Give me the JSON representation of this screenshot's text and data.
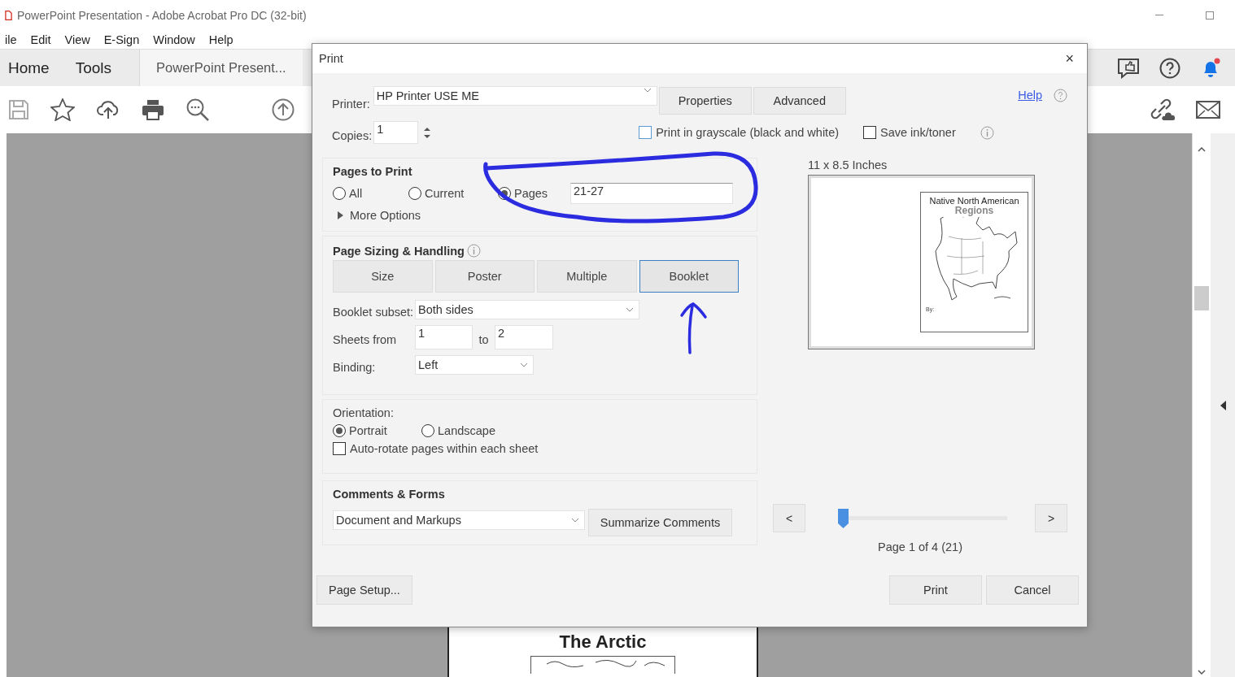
{
  "window": {
    "title": "PowerPoint Presentation - Adobe Acrobat Pro DC (32-bit)"
  },
  "menu": [
    "ile",
    "Edit",
    "View",
    "E-Sign",
    "Window",
    "Help"
  ],
  "tabs": [
    {
      "label": "Home",
      "selected": false
    },
    {
      "label": "Tools",
      "selected": false
    },
    {
      "label": "PowerPoint Present...",
      "selected": true
    }
  ],
  "notifications": {
    "unread": true
  },
  "document": {
    "page_title": "The Arctic"
  },
  "print_dialog": {
    "title": "Print",
    "close": "×",
    "printer": {
      "label": "Printer:",
      "value": "HP Printer USE ME"
    },
    "properties_button": "Properties",
    "advanced_button": "Advanced",
    "help_link": "Help",
    "copies": {
      "label": "Copies:",
      "value": "1"
    },
    "grayscale": {
      "label": "Print in grayscale (black and white)",
      "checked": false
    },
    "save_ink": {
      "label": "Save ink/toner",
      "checked": false
    },
    "pages_to_print": {
      "heading": "Pages to Print",
      "options": [
        {
          "label": "All",
          "selected": false
        },
        {
          "label": "Current",
          "selected": false
        },
        {
          "label": "Pages",
          "selected": true
        }
      ],
      "pages_value": "21-27",
      "more_options": "More Options"
    },
    "sizing": {
      "heading": "Page Sizing & Handling",
      "tabs": [
        {
          "label": "Size",
          "selected": false
        },
        {
          "label": "Poster",
          "selected": false
        },
        {
          "label": "Multiple",
          "selected": false
        },
        {
          "label": "Booklet",
          "selected": true
        }
      ],
      "booklet_subset": {
        "label": "Booklet subset:",
        "value": "Both sides"
      },
      "sheets": {
        "label": "Sheets from",
        "from": "1",
        "to_label": "to",
        "to": "2"
      },
      "binding": {
        "label": "Binding:",
        "value": "Left"
      }
    },
    "orientation": {
      "heading": "Orientation:",
      "options": [
        {
          "label": "Portrait",
          "selected": true
        },
        {
          "label": "Landscape",
          "selected": false
        }
      ],
      "auto_rotate": {
        "label": "Auto-rotate pages within each sheet",
        "checked": false
      }
    },
    "comments_forms": {
      "heading": "Comments & Forms",
      "value": "Document and Markups",
      "button": "Summarize Comments"
    },
    "preview": {
      "size": "11 x 8.5 Inches",
      "page_title": "Native North American",
      "page_subtitle": "Regions",
      "byline": "By:",
      "prev": "<",
      "next": ">",
      "level": 0,
      "status": "Page 1 of 4 (21)"
    },
    "page_setup": "Page Setup...",
    "print": "Print",
    "cancel": "Cancel"
  }
}
